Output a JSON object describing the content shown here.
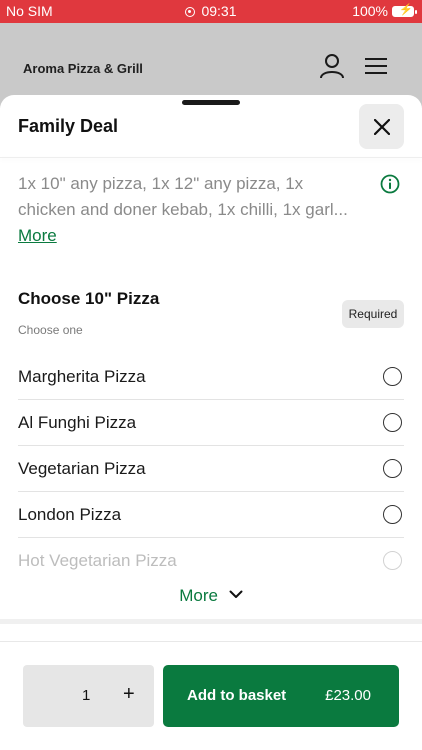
{
  "status_bar": {
    "carrier": "No SIM",
    "time": "09:31",
    "battery": "100%"
  },
  "app_header": {
    "brand": "Aroma Pizza & Grill"
  },
  "sheet": {
    "title": "Family Deal",
    "description_line1": "1x 10\" any pizza, 1x 12\" any pizza, 1x",
    "description_line2": "chicken and doner kebab, 1x chilli, 1x garl...",
    "description_more": "More",
    "section": {
      "title": "Choose 10\" Pizza",
      "subtitle": "Choose one",
      "badge": "Required",
      "options": [
        {
          "label": "Margherita Pizza"
        },
        {
          "label": "Al Funghi Pizza"
        },
        {
          "label": "Vegetarian Pizza"
        },
        {
          "label": "London Pizza"
        },
        {
          "label": "Hot Vegetarian Pizza"
        }
      ],
      "more_label": "More"
    }
  },
  "footer": {
    "quantity": "1",
    "plus": "+",
    "add_label": "Add to basket",
    "price": "£23.00"
  },
  "colors": {
    "status_bar": "#e0383e",
    "accent_green": "#0a7a3f",
    "overlay_gray": "#c9c9c9"
  }
}
